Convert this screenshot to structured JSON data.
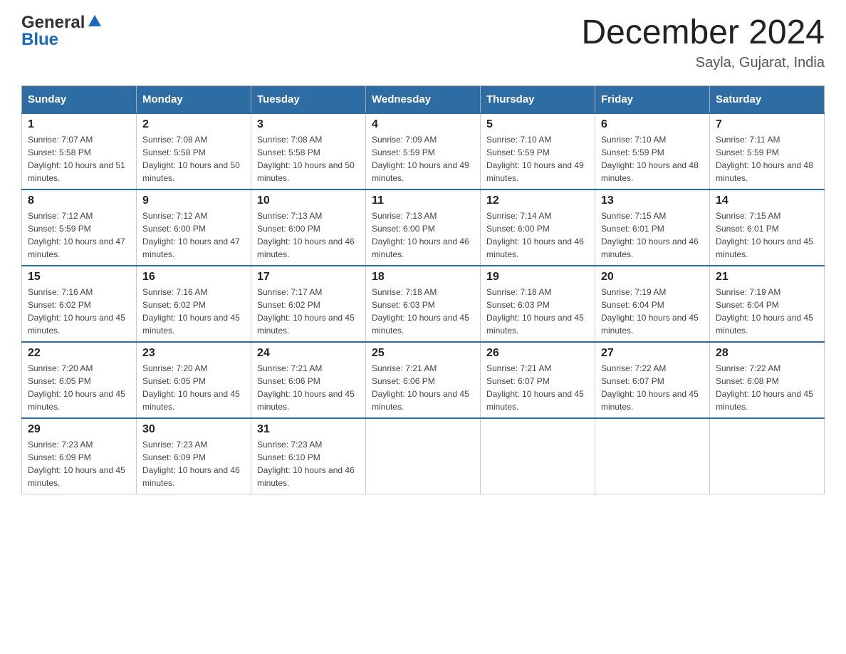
{
  "header": {
    "logo_general": "General",
    "logo_blue": "Blue",
    "month_year": "December 2024",
    "location": "Sayla, Gujarat, India"
  },
  "weekdays": [
    "Sunday",
    "Monday",
    "Tuesday",
    "Wednesday",
    "Thursday",
    "Friday",
    "Saturday"
  ],
  "weeks": [
    [
      {
        "day": "1",
        "sunrise": "7:07 AM",
        "sunset": "5:58 PM",
        "daylight": "10 hours and 51 minutes."
      },
      {
        "day": "2",
        "sunrise": "7:08 AM",
        "sunset": "5:58 PM",
        "daylight": "10 hours and 50 minutes."
      },
      {
        "day": "3",
        "sunrise": "7:08 AM",
        "sunset": "5:58 PM",
        "daylight": "10 hours and 50 minutes."
      },
      {
        "day": "4",
        "sunrise": "7:09 AM",
        "sunset": "5:59 PM",
        "daylight": "10 hours and 49 minutes."
      },
      {
        "day": "5",
        "sunrise": "7:10 AM",
        "sunset": "5:59 PM",
        "daylight": "10 hours and 49 minutes."
      },
      {
        "day": "6",
        "sunrise": "7:10 AM",
        "sunset": "5:59 PM",
        "daylight": "10 hours and 48 minutes."
      },
      {
        "day": "7",
        "sunrise": "7:11 AM",
        "sunset": "5:59 PM",
        "daylight": "10 hours and 48 minutes."
      }
    ],
    [
      {
        "day": "8",
        "sunrise": "7:12 AM",
        "sunset": "5:59 PM",
        "daylight": "10 hours and 47 minutes."
      },
      {
        "day": "9",
        "sunrise": "7:12 AM",
        "sunset": "6:00 PM",
        "daylight": "10 hours and 47 minutes."
      },
      {
        "day": "10",
        "sunrise": "7:13 AM",
        "sunset": "6:00 PM",
        "daylight": "10 hours and 46 minutes."
      },
      {
        "day": "11",
        "sunrise": "7:13 AM",
        "sunset": "6:00 PM",
        "daylight": "10 hours and 46 minutes."
      },
      {
        "day": "12",
        "sunrise": "7:14 AM",
        "sunset": "6:00 PM",
        "daylight": "10 hours and 46 minutes."
      },
      {
        "day": "13",
        "sunrise": "7:15 AM",
        "sunset": "6:01 PM",
        "daylight": "10 hours and 46 minutes."
      },
      {
        "day": "14",
        "sunrise": "7:15 AM",
        "sunset": "6:01 PM",
        "daylight": "10 hours and 45 minutes."
      }
    ],
    [
      {
        "day": "15",
        "sunrise": "7:16 AM",
        "sunset": "6:02 PM",
        "daylight": "10 hours and 45 minutes."
      },
      {
        "day": "16",
        "sunrise": "7:16 AM",
        "sunset": "6:02 PM",
        "daylight": "10 hours and 45 minutes."
      },
      {
        "day": "17",
        "sunrise": "7:17 AM",
        "sunset": "6:02 PM",
        "daylight": "10 hours and 45 minutes."
      },
      {
        "day": "18",
        "sunrise": "7:18 AM",
        "sunset": "6:03 PM",
        "daylight": "10 hours and 45 minutes."
      },
      {
        "day": "19",
        "sunrise": "7:18 AM",
        "sunset": "6:03 PM",
        "daylight": "10 hours and 45 minutes."
      },
      {
        "day": "20",
        "sunrise": "7:19 AM",
        "sunset": "6:04 PM",
        "daylight": "10 hours and 45 minutes."
      },
      {
        "day": "21",
        "sunrise": "7:19 AM",
        "sunset": "6:04 PM",
        "daylight": "10 hours and 45 minutes."
      }
    ],
    [
      {
        "day": "22",
        "sunrise": "7:20 AM",
        "sunset": "6:05 PM",
        "daylight": "10 hours and 45 minutes."
      },
      {
        "day": "23",
        "sunrise": "7:20 AM",
        "sunset": "6:05 PM",
        "daylight": "10 hours and 45 minutes."
      },
      {
        "day": "24",
        "sunrise": "7:21 AM",
        "sunset": "6:06 PM",
        "daylight": "10 hours and 45 minutes."
      },
      {
        "day": "25",
        "sunrise": "7:21 AM",
        "sunset": "6:06 PM",
        "daylight": "10 hours and 45 minutes."
      },
      {
        "day": "26",
        "sunrise": "7:21 AM",
        "sunset": "6:07 PM",
        "daylight": "10 hours and 45 minutes."
      },
      {
        "day": "27",
        "sunrise": "7:22 AM",
        "sunset": "6:07 PM",
        "daylight": "10 hours and 45 minutes."
      },
      {
        "day": "28",
        "sunrise": "7:22 AM",
        "sunset": "6:08 PM",
        "daylight": "10 hours and 45 minutes."
      }
    ],
    [
      {
        "day": "29",
        "sunrise": "7:23 AM",
        "sunset": "6:09 PM",
        "daylight": "10 hours and 45 minutes."
      },
      {
        "day": "30",
        "sunrise": "7:23 AM",
        "sunset": "6:09 PM",
        "daylight": "10 hours and 46 minutes."
      },
      {
        "day": "31",
        "sunrise": "7:23 AM",
        "sunset": "6:10 PM",
        "daylight": "10 hours and 46 minutes."
      },
      null,
      null,
      null,
      null
    ]
  ],
  "labels": {
    "sunrise": "Sunrise:",
    "sunset": "Sunset:",
    "daylight": "Daylight:"
  }
}
